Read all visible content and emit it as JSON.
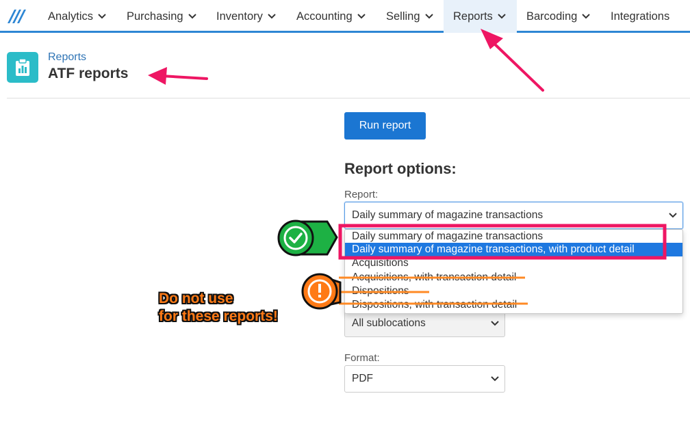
{
  "nav": {
    "items": [
      {
        "label": "Analytics"
      },
      {
        "label": "Purchasing"
      },
      {
        "label": "Inventory"
      },
      {
        "label": "Accounting"
      },
      {
        "label": "Selling"
      },
      {
        "label": "Reports"
      },
      {
        "label": "Barcoding"
      },
      {
        "label": "Integrations"
      }
    ],
    "active": "Reports",
    "accent_color": "#2d86d4"
  },
  "header": {
    "breadcrumb": "Reports",
    "title": "ATF reports",
    "icon": "clipboard-chart-icon",
    "icon_color": "#2bbcc8"
  },
  "actions": {
    "run_label": "Run report",
    "run_color": "#1b76d2"
  },
  "options": {
    "title": "Report options:",
    "report_label": "Report:",
    "report_value": "Daily summary of magazine transactions",
    "report_options": [
      "Daily summary of magazine transactions",
      "Daily summary of magazine transactions, with product detail",
      "Acquisitions",
      "Acquisitions, with transaction detail",
      "Dispositions",
      "Dispositions, with transaction detail"
    ],
    "highlighted_option": "Daily summary of magazine transactions, with product detail",
    "sublocation_value": "All sublocations",
    "format_label": "Format:",
    "format_value": "PDF"
  },
  "annotations": {
    "warning_text_line1": "Do not use",
    "warning_text_line2": "for these reports!",
    "ok_badge_icon": "checkmark-icon",
    "warning_badge_icon": "exclamation-icon",
    "arrow_color": "#f0205f",
    "warning_color": "#ff7a16",
    "ok_color": "#20b040"
  }
}
